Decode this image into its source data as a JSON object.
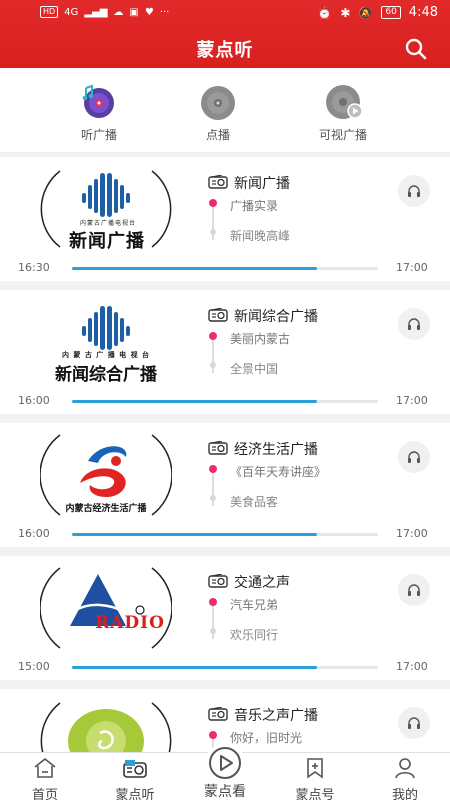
{
  "status_bar": {
    "left_badge": "HD",
    "network": "4G",
    "time": "4:48",
    "battery": "60",
    "more": "···"
  },
  "header": {
    "title": "蒙点听"
  },
  "categories": [
    {
      "label": "听广播"
    },
    {
      "label": "点播"
    },
    {
      "label": "可视广播"
    }
  ],
  "channels": [
    {
      "name": "新闻广播",
      "logo_top": "内蒙古广播电视台",
      "logo_main": "新闻广播",
      "program_now": "广播实录",
      "program_next": "新闻晚高峰",
      "start": "16:30",
      "end": "17:00",
      "progress": 0.8
    },
    {
      "name": "新闻综合广播",
      "logo_top": "内 蒙 古 广 播 电 视 台",
      "logo_main": "新闻综合广播",
      "program_now": "美丽内蒙古",
      "program_next": "全景中国",
      "start": "16:00",
      "end": "17:00",
      "progress": 0.8
    },
    {
      "name": "经济生活广播",
      "logo_main": "内蒙古经济生活广播",
      "program_now": "《百年天寿讲座》",
      "program_next": "美食品客",
      "start": "16:00",
      "end": "17:00",
      "progress": 0.8
    },
    {
      "name": "交通之声",
      "logo_main": "RADIO",
      "program_now": "汽车兄弟",
      "program_next": "欢乐同行",
      "start": "15:00",
      "end": "17:00",
      "progress": 0.8
    },
    {
      "name": "音乐之声广播",
      "program_now": "你好，旧时光"
    }
  ],
  "bottom_nav": [
    {
      "label": "首页",
      "icon": "home-icon"
    },
    {
      "label": "蒙点听",
      "icon": "radio-icon"
    },
    {
      "label": "蒙点看",
      "icon": "play-icon"
    },
    {
      "label": "蒙点号",
      "icon": "bookmark-plus-icon"
    },
    {
      "label": "我的",
      "icon": "person-icon"
    }
  ],
  "colors": {
    "header_red": "#e22a2b",
    "progress_blue": "#2a9fd8",
    "dot_pink": "#e8306b"
  }
}
